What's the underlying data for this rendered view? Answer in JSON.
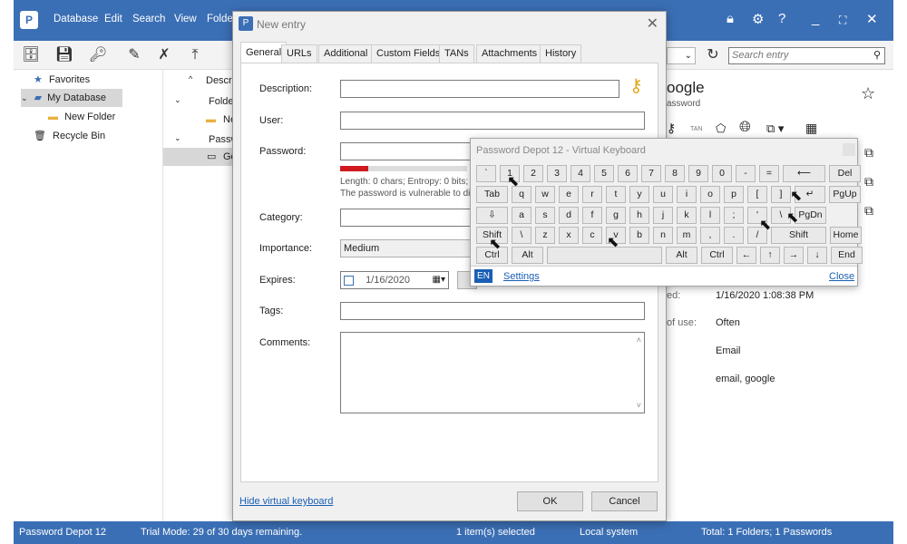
{
  "app": {
    "menus": [
      "Database",
      "Edit",
      "Search",
      "View",
      "Folder"
    ],
    "search_placeholder": "Search entry",
    "tree": [
      {
        "label": "Favorites"
      },
      {
        "label": "My Database"
      },
      {
        "label": "New Folder"
      },
      {
        "label": "Recycle Bin"
      }
    ],
    "mid_column_header": "Descri",
    "mid_rows": [
      "Folde",
      "Ne",
      "Passw",
      "Go"
    ],
    "right": {
      "entry_title": "oogle",
      "entry_subtitle": "assword",
      "details": [
        {
          "label": "ed:",
          "value": "1/16/2020 1:08:38 PM"
        },
        {
          "label": "of use:",
          "value": "Often"
        },
        {
          "label": "",
          "value": "Email"
        },
        {
          "label": "",
          "value": "email, google"
        }
      ]
    },
    "status": {
      "app": "Password Depot 12",
      "trial": "Trial Mode: 29 of 30 days remaining.",
      "selected": "1 item(s) selected",
      "location": "Local system",
      "total": "Total: 1 Folders; 1 Passwords"
    }
  },
  "dialog": {
    "title": "New entry",
    "tabs": [
      "General",
      "URLs",
      "Additional",
      "Custom Fields",
      "TANs",
      "Attachments",
      "History"
    ],
    "labels": {
      "description": "Description:",
      "user": "User:",
      "password": "Password:",
      "category": "Category:",
      "importance": "Importance:",
      "expires": "Expires:",
      "tags": "Tags:",
      "comments": "Comments:"
    },
    "password_info": "Length: 0 chars; Entropy: 0 bits;",
    "password_warning": "The password is vulnerable to di",
    "importance_value": "Medium",
    "expires_value": "1/16/2020",
    "hide_keyboard_link": "Hide virtual keyboard",
    "ok_label": "OK",
    "cancel_label": "Cancel"
  },
  "vkb": {
    "title": "Password Depot 12 - Virtual Keyboard",
    "row1": [
      "`",
      "1",
      "2",
      "3",
      "4",
      "5",
      "6",
      "7",
      "8",
      "9",
      "0",
      "-",
      "=",
      "⟵",
      "Del"
    ],
    "row2": [
      "Tab",
      "q",
      "w",
      "e",
      "r",
      "t",
      "y",
      "u",
      "i",
      "o",
      "p",
      "[",
      "]",
      "↵",
      "PgUp"
    ],
    "row3": [
      "⇩",
      "a",
      "s",
      "d",
      "f",
      "g",
      "h",
      "j",
      "k",
      "l",
      ";",
      "'",
      "\\",
      "PgDn"
    ],
    "row4": [
      "Shift",
      "\\",
      "z",
      "x",
      "c",
      "v",
      "b",
      "n",
      "m",
      ",",
      ".",
      "/",
      "Shift",
      "Home"
    ],
    "row5": [
      "Ctrl",
      "Alt",
      "",
      "Alt",
      "Ctrl",
      "←",
      "↑",
      "→",
      "↓",
      "End"
    ],
    "lang": "EN",
    "settings_label": "Settings",
    "close_label": "Close"
  }
}
